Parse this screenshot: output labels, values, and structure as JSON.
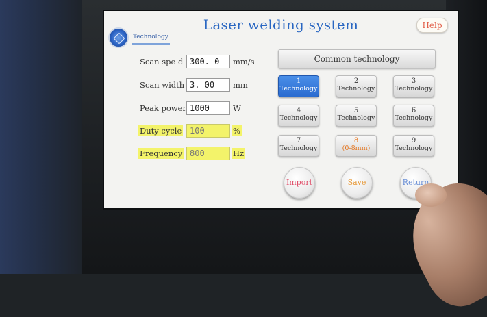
{
  "screen": {
    "title": "Laser welding system",
    "help_label": "Help",
    "badge_label": "Technology"
  },
  "params": [
    {
      "label": "Scan spe d",
      "value": "300. 0",
      "unit": "mm/s",
      "highlighted": false
    },
    {
      "label": "Scan width",
      "value": "3. 00",
      "unit": "mm",
      "highlighted": false
    },
    {
      "label": "Peak power",
      "value": "1000",
      "unit": "W",
      "highlighted": false
    },
    {
      "label": "Duty cycle",
      "value": "100",
      "unit": "%",
      "highlighted": true
    },
    {
      "label": "Frequency",
      "value": "800",
      "unit": "Hz",
      "highlighted": true
    }
  ],
  "common_label": "Common technology",
  "technologies": [
    {
      "num": "1",
      "label": "Technology",
      "state": "active"
    },
    {
      "num": "2",
      "label": "Technology",
      "state": "normal"
    },
    {
      "num": "3",
      "label": "Technology",
      "state": "normal"
    },
    {
      "num": "4",
      "label": "Technology",
      "state": "normal"
    },
    {
      "num": "5",
      "label": "Technology",
      "state": "normal"
    },
    {
      "num": "6",
      "label": "Technology",
      "state": "normal"
    },
    {
      "num": "7",
      "label": "Technology",
      "state": "normal"
    },
    {
      "num": "8",
      "label": "(0-8mm)",
      "state": "orange"
    },
    {
      "num": "9",
      "label": "Technology",
      "state": "normal"
    }
  ],
  "actions": {
    "import_label": "Import",
    "save_label": "Save",
    "return_label": "Return"
  },
  "colors": {
    "title_blue": "#2a67c2",
    "active_blue": "#2a6bd0",
    "highlight_yellow": "#f3f36a",
    "import_red": "#e0506a",
    "save_orange": "#e79a3a"
  }
}
